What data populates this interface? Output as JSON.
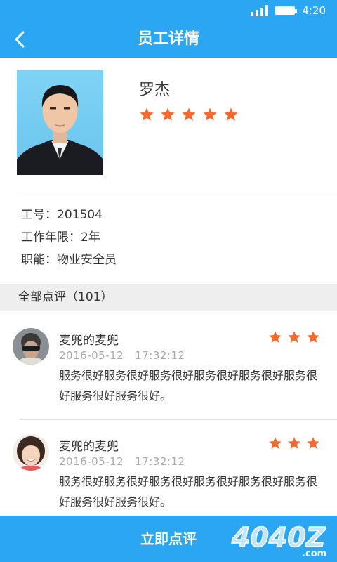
{
  "status_bar": {
    "time": "4:20",
    "signal_bars": 4,
    "battery_level": 1.0
  },
  "header": {
    "title": "员工详情",
    "back_icon": "chevron-left-icon"
  },
  "profile": {
    "name": "罗杰",
    "rating": 5,
    "rating_max": 5,
    "id_line": "工号：201504",
    "years_line": "工作年限：2年",
    "role_line": "职能：物业安全员"
  },
  "reviews_section": {
    "title": "全部点评（101）"
  },
  "reviews": [
    {
      "name": "麦兜的麦兜",
      "date": "2016-05-12",
      "time": "17:32:12",
      "rating": 3,
      "text": "服务很好服务很好服务很好服务很好服务很好服务很好服务很好服务很好。"
    },
    {
      "name": "麦兜的麦兜",
      "date": "2016-05-12",
      "time": "17:32:12",
      "rating": 3,
      "text": "服务很好服务很好服务很好服务很好服务很好服务很好服务很好服务很好。"
    }
  ],
  "bottom_bar": {
    "action_label": "立即点评"
  },
  "watermark": {
    "text": "4040Z.com"
  },
  "colors": {
    "primary": "#2aa6f2",
    "star": "#f26a2f",
    "section_bg": "#eeeeee",
    "meta_text": "#aaaaaa"
  }
}
